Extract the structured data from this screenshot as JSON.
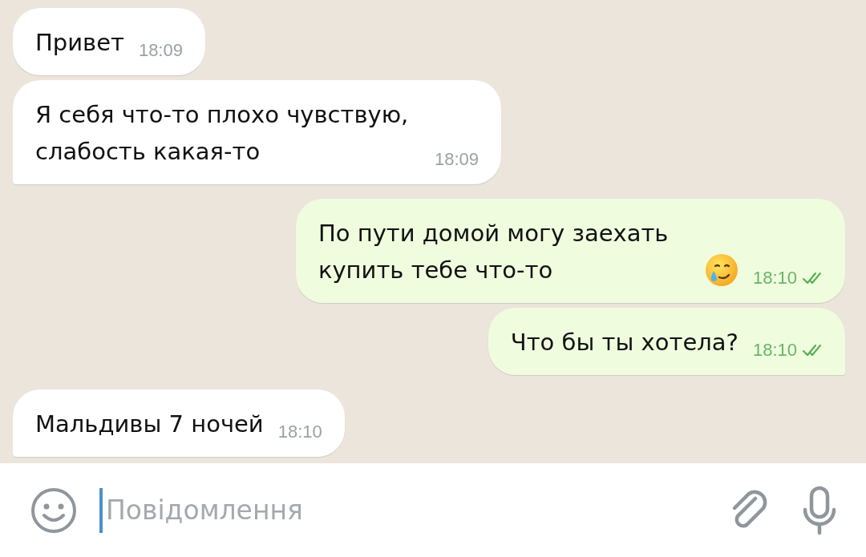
{
  "messages": [
    {
      "kind": "incoming",
      "text": "Привет",
      "time": "18:09",
      "tail": false
    },
    {
      "kind": "incoming",
      "text": "Я себя что-то плохо чувствую, слабость какая-то",
      "time": "18:09",
      "tail": true
    },
    {
      "kind": "outgoing",
      "text": "По пути домой могу заехать купить тебе что-то",
      "emoji": true,
      "time": "18:10",
      "read": true,
      "tail": false
    },
    {
      "kind": "outgoing",
      "text": "Что бы ты хотела?",
      "time": "18:10",
      "read": true,
      "tail": true
    },
    {
      "kind": "incoming",
      "text": "Мальдивы 7 ночей",
      "time": "18:10",
      "tail": true
    }
  ],
  "composer": {
    "placeholder": "Повідомлення"
  }
}
